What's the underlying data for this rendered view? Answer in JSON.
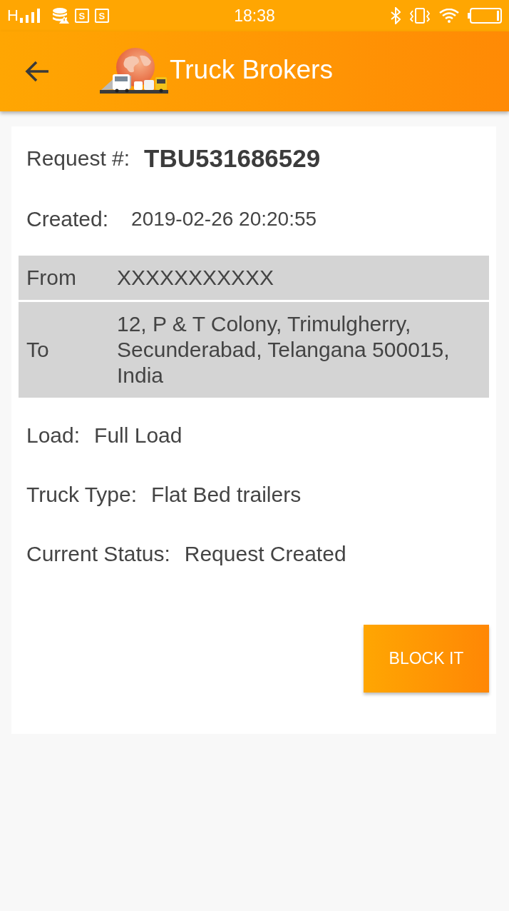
{
  "status_bar": {
    "network": "H",
    "notifications": [
      {
        "glyph": "S"
      },
      {
        "glyph": "S"
      }
    ],
    "time": "18:38"
  },
  "toolbar": {
    "title": "Truck Brokers"
  },
  "request": {
    "number_label": "Request #:",
    "number": "TBU531686529",
    "created_label": "Created:",
    "created": "2019-02-26 20:20:55"
  },
  "route": [
    {
      "label": "From",
      "value": "XXXXXXXXXXX"
    },
    {
      "label": "To",
      "value": "12, P & T Colony, Trimulgherry, Secunderabad, Telangana 500015, India"
    }
  ],
  "details": [
    {
      "label": "Load:",
      "value": "Full Load"
    },
    {
      "label": "Truck Type:",
      "value": "Flat Bed trailers"
    },
    {
      "label": "Current Status:",
      "value": "Request Created"
    }
  ],
  "actions": [
    {
      "label": "BLOCK IT"
    }
  ]
}
